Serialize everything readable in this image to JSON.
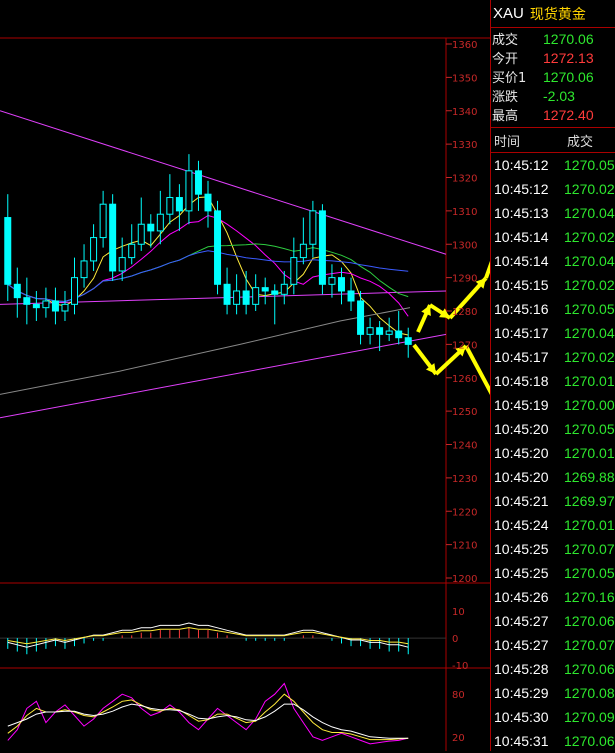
{
  "quote": {
    "symbol": "XAU",
    "name": "现货黄金",
    "rows": [
      {
        "label": "成交",
        "value": "1270.06",
        "color": "#2ee82e"
      },
      {
        "label": "今开",
        "value": "1272.13",
        "color": "#ff3b3b"
      },
      {
        "label": "买价1",
        "value": "1270.06",
        "color": "#2ee82e"
      },
      {
        "label": "涨跌",
        "value": "-2.03",
        "color": "#2ee82e"
      },
      {
        "label": "最高",
        "value": "1272.40",
        "color": "#ff3b3b"
      }
    ]
  },
  "ticks": {
    "header_time": "时间",
    "header_price": "成交",
    "rows": [
      {
        "time": "10:45:12",
        "price": "1270.05"
      },
      {
        "time": "10:45:12",
        "price": "1270.02"
      },
      {
        "time": "10:45:13",
        "price": "1270.04"
      },
      {
        "time": "10:45:14",
        "price": "1270.02"
      },
      {
        "time": "10:45:14",
        "price": "1270.04"
      },
      {
        "time": "10:45:15",
        "price": "1270.02"
      },
      {
        "time": "10:45:16",
        "price": "1270.05"
      },
      {
        "time": "10:45:17",
        "price": "1270.04"
      },
      {
        "time": "10:45:17",
        "price": "1270.02"
      },
      {
        "time": "10:45:18",
        "price": "1270.01"
      },
      {
        "time": "10:45:19",
        "price": "1270.00"
      },
      {
        "time": "10:45:20",
        "price": "1270.05"
      },
      {
        "time": "10:45:20",
        "price": "1270.01"
      },
      {
        "time": "10:45:20",
        "price": "1269.88"
      },
      {
        "time": "10:45:21",
        "price": "1269.97"
      },
      {
        "time": "10:45:24",
        "price": "1270.01"
      },
      {
        "time": "10:45:25",
        "price": "1270.07"
      },
      {
        "time": "10:45:25",
        "price": "1270.05"
      },
      {
        "time": "10:45:26",
        "price": "1270.16"
      },
      {
        "time": "10:45:27",
        "price": "1270.06"
      },
      {
        "time": "10:45:27",
        "price": "1270.07"
      },
      {
        "time": "10:45:28",
        "price": "1270.06"
      },
      {
        "time": "10:45:29",
        "price": "1270.08"
      },
      {
        "time": "10:45:30",
        "price": "1270.09"
      },
      {
        "time": "10:45:31",
        "price": "1270.06"
      }
    ]
  },
  "colors": {
    "up": "#ff3b3b",
    "down": "#2ee82e",
    "time": "#ffffff",
    "axis": "#c62828",
    "candle": "#00ffff"
  },
  "chart_data": {
    "type": "candlestick",
    "price_axis": [
      1360,
      1350,
      1340,
      1330,
      1320,
      1310,
      1300,
      1290,
      1280,
      1270,
      1260,
      1250,
      1240,
      1230,
      1220,
      1210,
      1200
    ],
    "ylim": [
      1200,
      1360
    ],
    "candles": [
      {
        "o": 1308,
        "c": 1288,
        "h": 1315,
        "l": 1283
      },
      {
        "o": 1288,
        "c": 1284,
        "h": 1293,
        "l": 1278
      },
      {
        "o": 1284,
        "c": 1282,
        "h": 1290,
        "l": 1276
      },
      {
        "o": 1282,
        "c": 1281,
        "h": 1286,
        "l": 1277
      },
      {
        "o": 1281,
        "c": 1283,
        "h": 1287,
        "l": 1278
      },
      {
        "o": 1283,
        "c": 1280,
        "h": 1287,
        "l": 1276
      },
      {
        "o": 1280,
        "c": 1282,
        "h": 1286,
        "l": 1277
      },
      {
        "o": 1282,
        "c": 1290,
        "h": 1296,
        "l": 1279
      },
      {
        "o": 1290,
        "c": 1295,
        "h": 1300,
        "l": 1287
      },
      {
        "o": 1295,
        "c": 1302,
        "h": 1306,
        "l": 1292
      },
      {
        "o": 1302,
        "c": 1312,
        "h": 1316,
        "l": 1299
      },
      {
        "o": 1312,
        "c": 1292,
        "h": 1315,
        "l": 1289
      },
      {
        "o": 1292,
        "c": 1296,
        "h": 1302,
        "l": 1289
      },
      {
        "o": 1296,
        "c": 1300,
        "h": 1306,
        "l": 1294
      },
      {
        "o": 1300,
        "c": 1306,
        "h": 1314,
        "l": 1298
      },
      {
        "o": 1306,
        "c": 1304,
        "h": 1309,
        "l": 1299
      },
      {
        "o": 1304,
        "c": 1309,
        "h": 1316,
        "l": 1300
      },
      {
        "o": 1309,
        "c": 1314,
        "h": 1321,
        "l": 1306
      },
      {
        "o": 1314,
        "c": 1310,
        "h": 1318,
        "l": 1304
      },
      {
        "o": 1310,
        "c": 1322,
        "h": 1327,
        "l": 1306
      },
      {
        "o": 1322,
        "c": 1315,
        "h": 1325,
        "l": 1310
      },
      {
        "o": 1315,
        "c": 1310,
        "h": 1319,
        "l": 1305
      },
      {
        "o": 1310,
        "c": 1288,
        "h": 1313,
        "l": 1285
      },
      {
        "o": 1288,
        "c": 1282,
        "h": 1293,
        "l": 1279
      },
      {
        "o": 1282,
        "c": 1286,
        "h": 1291,
        "l": 1279
      },
      {
        "o": 1286,
        "c": 1282,
        "h": 1292,
        "l": 1279
      },
      {
        "o": 1282,
        "c": 1287,
        "h": 1291,
        "l": 1280
      },
      {
        "o": 1287,
        "c": 1286,
        "h": 1290,
        "l": 1282
      },
      {
        "o": 1286,
        "c": 1285,
        "h": 1288,
        "l": 1276
      },
      {
        "o": 1285,
        "c": 1288,
        "h": 1292,
        "l": 1282
      },
      {
        "o": 1288,
        "c": 1296,
        "h": 1302,
        "l": 1285
      },
      {
        "o": 1296,
        "c": 1300,
        "h": 1308,
        "l": 1294
      },
      {
        "o": 1300,
        "c": 1310,
        "h": 1313,
        "l": 1296
      },
      {
        "o": 1310,
        "c": 1288,
        "h": 1312,
        "l": 1285
      },
      {
        "o": 1288,
        "c": 1290,
        "h": 1294,
        "l": 1284
      },
      {
        "o": 1290,
        "c": 1286,
        "h": 1293,
        "l": 1282
      },
      {
        "o": 1286,
        "c": 1283,
        "h": 1290,
        "l": 1280
      },
      {
        "o": 1283,
        "c": 1273,
        "h": 1286,
        "l": 1270
      },
      {
        "o": 1273,
        "c": 1275,
        "h": 1278,
        "l": 1270
      },
      {
        "o": 1275,
        "c": 1273,
        "h": 1277,
        "l": 1268
      },
      {
        "o": 1273,
        "c": 1274,
        "h": 1278,
        "l": 1271
      },
      {
        "o": 1274,
        "c": 1272,
        "h": 1280,
        "l": 1270
      },
      {
        "o": 1272,
        "c": 1270,
        "h": 1275,
        "l": 1266
      }
    ],
    "macd_axis": [
      10,
      0,
      -10
    ],
    "macd_ylim": [
      -10,
      16
    ],
    "macd_values": [
      -4,
      -5,
      -6,
      -5,
      -4,
      -3,
      -4,
      -3,
      -2,
      -1,
      -1,
      0,
      1,
      1,
      2,
      2,
      3,
      3,
      3,
      4,
      3,
      3,
      2,
      1,
      0,
      -1,
      -1,
      -1,
      -1,
      -1,
      0,
      1,
      1,
      0,
      -1,
      -2,
      -3,
      -3,
      -4,
      -4,
      -5,
      -5,
      -6
    ],
    "kdj_axis": [
      80,
      20
    ],
    "kdj_ylim": [
      0,
      100
    ]
  }
}
